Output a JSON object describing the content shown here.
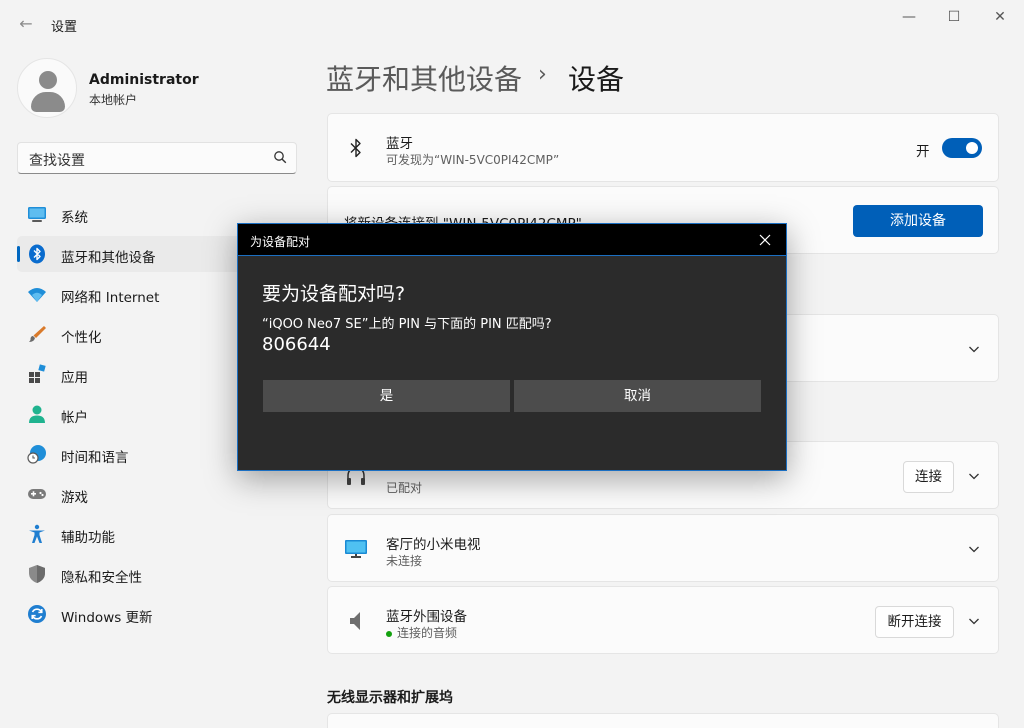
{
  "window": {
    "title": "设置",
    "back_glyph": "←",
    "minimize_glyph": "—",
    "maximize_glyph": "☐",
    "close_glyph": "✕"
  },
  "profile": {
    "name": "Administrator",
    "account_type": "本地帐户"
  },
  "search": {
    "placeholder": "查找设置"
  },
  "sidebar": {
    "items": [
      {
        "label": "系统",
        "icon": "system-icon"
      },
      {
        "label": "蓝牙和其他设备",
        "icon": "bluetooth-icon",
        "active": true
      },
      {
        "label": "网络和 Internet",
        "icon": "wifi-icon"
      },
      {
        "label": "个性化",
        "icon": "brush-icon"
      },
      {
        "label": "应用",
        "icon": "apps-icon"
      },
      {
        "label": "帐户",
        "icon": "account-icon"
      },
      {
        "label": "时间和语言",
        "icon": "globe-clock-icon"
      },
      {
        "label": "游戏",
        "icon": "gamepad-icon"
      },
      {
        "label": "辅助功能",
        "icon": "accessibility-icon"
      },
      {
        "label": "隐私和安全性",
        "icon": "shield-icon"
      },
      {
        "label": "Windows 更新",
        "icon": "update-icon"
      }
    ]
  },
  "header": {
    "parent": "蓝牙和其他设备",
    "separator": "›",
    "current": "设备"
  },
  "bluetooth_card": {
    "title": "蓝牙",
    "subtitle": "可发现为“WIN-5VC0PI42CMP”",
    "toggle_label": "开",
    "toggle_on": true
  },
  "add_card": {
    "text": "将新设备连接到 \"WIN-5VC0PI42CMP\"",
    "button": "添加设备"
  },
  "devices": [
    {
      "title": "",
      "status": "已配对",
      "button": "连接",
      "icon": "headset-icon"
    },
    {
      "title": "客厅的小米电视",
      "status": "未连接",
      "button": "",
      "icon": "monitor-icon"
    },
    {
      "title": "蓝牙外围设备",
      "status": "连接的音频",
      "button": "断开连接",
      "icon": "speaker-icon",
      "status_color": "#13a10e"
    }
  ],
  "sections": {
    "wireless_displays": "无线显示器和扩展坞"
  },
  "dialog": {
    "title": "为设备配对",
    "heading": "要为设备配对吗?",
    "question": "“iQOO Neo7 SE”上的 PIN 与下面的 PIN 匹配吗?",
    "pin": "806644",
    "yes_button": "是",
    "cancel_button": "取消"
  },
  "colors": {
    "accent": "#005fb8",
    "dialog_bg": "#2b2b2b",
    "dialog_border": "#1b6fc2"
  }
}
